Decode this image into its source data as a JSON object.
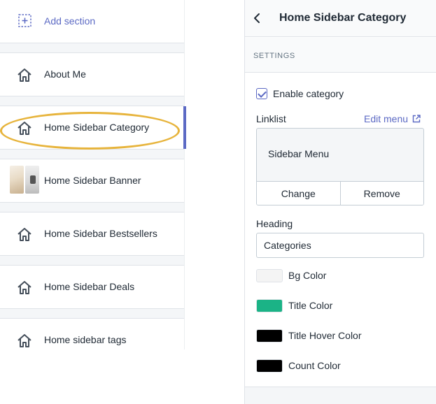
{
  "left": {
    "add_section": "Add section",
    "items": [
      {
        "label": "About Me",
        "icon": "home-icon"
      },
      {
        "label": "Home Sidebar Category",
        "icon": "home-icon"
      },
      {
        "label": "Home Sidebar Banner",
        "icon": "thumbnail"
      },
      {
        "label": "Home Sidebar Bestsellers",
        "icon": "home-icon"
      },
      {
        "label": "Home Sidebar Deals",
        "icon": "home-icon"
      },
      {
        "label": "Home sidebar tags",
        "icon": "home-icon"
      }
    ]
  },
  "right": {
    "title": "Home Sidebar Category",
    "settings_header": "SETTINGS",
    "enable_category": {
      "label": "Enable category",
      "checked": true
    },
    "linklist": {
      "label": "Linklist",
      "edit_menu": "Edit menu",
      "menu_name": "Sidebar Menu",
      "change": "Change",
      "remove": "Remove"
    },
    "heading": {
      "label": "Heading",
      "value": "Categories"
    },
    "colors": [
      {
        "label": "Bg Color",
        "value": "#f4f4f4"
      },
      {
        "label": "Title Color",
        "value": "#1bb386"
      },
      {
        "label": "Title Hover Color",
        "value": "#000000"
      },
      {
        "label": "Count Color",
        "value": "#000000"
      }
    ]
  },
  "theme": {
    "accent": "#5c6ac4",
    "highlight": "#e7b43c"
  }
}
